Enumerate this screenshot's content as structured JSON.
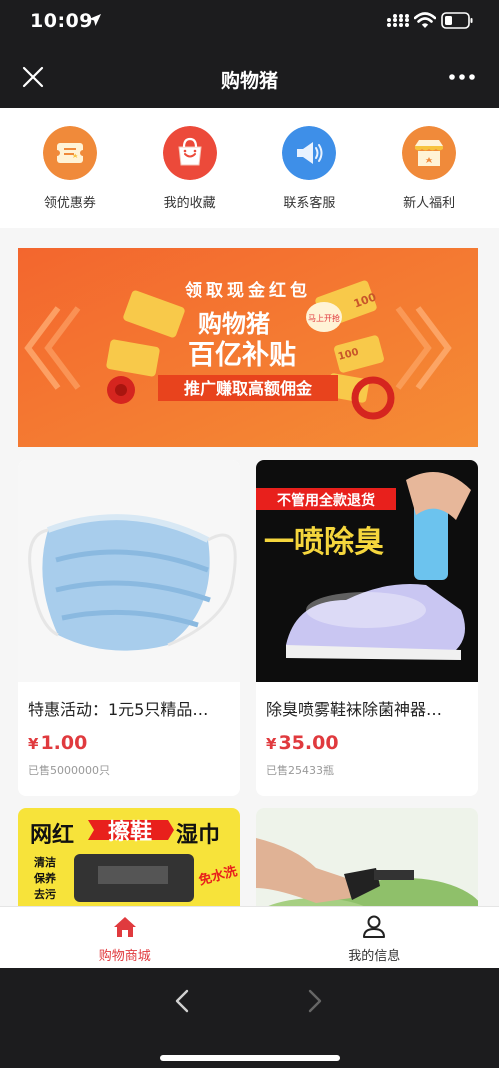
{
  "status_bar": {
    "time": "10:09"
  },
  "nav": {
    "title": "购物猪"
  },
  "quick_links": [
    {
      "label": "领优惠券",
      "icon": "coupon-icon"
    },
    {
      "label": "我的收藏",
      "icon": "favorites-bag-icon"
    },
    {
      "label": "联系客服",
      "icon": "megaphone-icon"
    },
    {
      "label": "新人福利",
      "icon": "gift-shop-icon"
    }
  ],
  "banner": {
    "line1": "领取现金红包",
    "line2": "购物猪",
    "line3": "百亿补贴",
    "line4": "推广赚取高额佣金",
    "badge": "马上开抢",
    "ticket_value": "100",
    "colors": {
      "bg_start": "#f05a28",
      "bg_end": "#f7923a",
      "gold": "#f8c94a"
    }
  },
  "products": [
    {
      "title": "特惠活动：1元5只精品…",
      "currency": "¥",
      "price": "1.00",
      "sold": "已售5000000只",
      "image": "face-mask-image"
    },
    {
      "title": "除臭喷雾鞋袜除菌神器…",
      "currency": "¥",
      "price": "35.00",
      "sold": "已售25433瓶",
      "image": "shoe-spray-image",
      "image_text": {
        "tag": "不管用全款退货",
        "headline": "一喷除臭"
      }
    },
    {
      "title": "",
      "image": "shoe-wipes-image",
      "image_text": {
        "headline_a": "网红",
        "headline_b": "擦鞋",
        "headline_c": "湿巾",
        "bullets": [
          "清洁",
          "保养",
          "去污"
        ],
        "tag": "免水洗"
      }
    },
    {
      "title": "",
      "image": "garden-sprayer-image"
    }
  ],
  "tabbar": {
    "items": [
      {
        "label": "购物商城",
        "icon": "home-icon",
        "active": true
      },
      {
        "label": "我的信息",
        "icon": "user-icon",
        "active": false
      }
    ]
  },
  "theme": {
    "accent": "#e03a3e",
    "dark": "#1c1c1e"
  }
}
